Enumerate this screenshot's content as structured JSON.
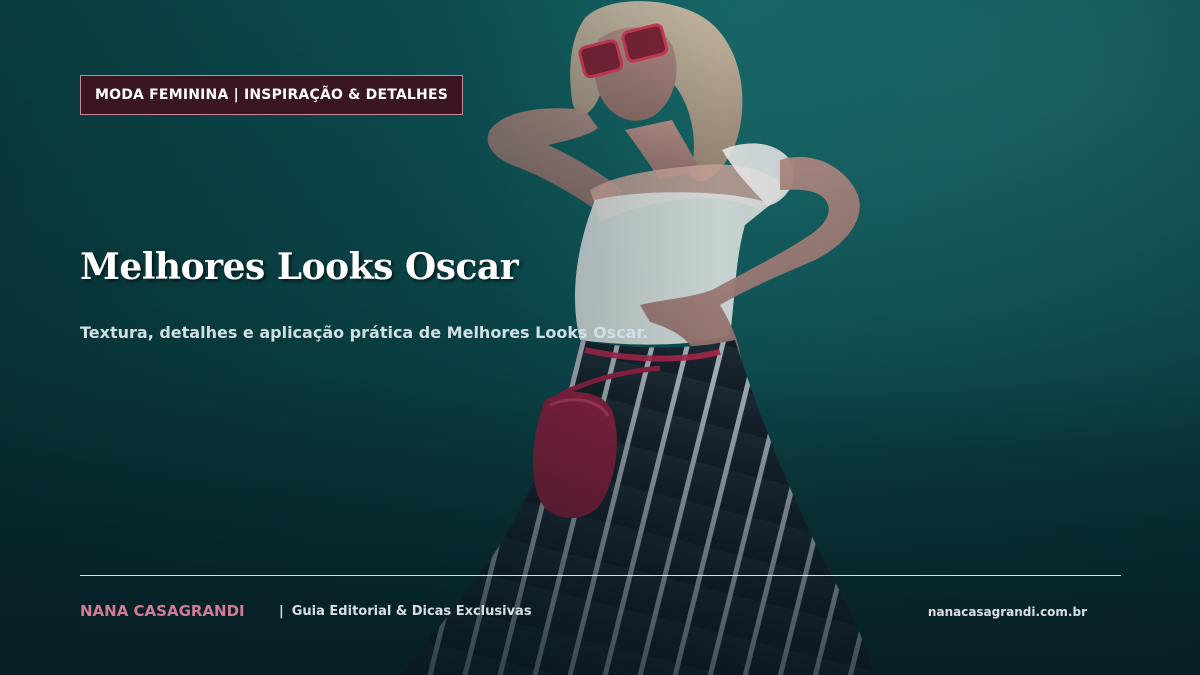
{
  "category_badge": "MODA FEMININA | INSPIRAÇÃO & DETALHES",
  "title": "Melhores Looks Oscar",
  "subtitle": "Textura, detalhes e aplicação prática de Melhores Looks Oscar.",
  "footer": {
    "brand": "NANA CASAGRANDI",
    "separator": "|",
    "tagline": "Guia Editorial & Dicas Exclusivas",
    "site_url": "nanacasagrandi.com.br"
  },
  "colors": {
    "background_teal": "#0f5d5e",
    "badge_background": "#3a1620",
    "badge_border": "#c98a97",
    "brand_pink": "#d27b95",
    "title_white": "#ffffff",
    "subtitle_text": "#cfe0e4"
  },
  "photo": {
    "subject": "woman-posing-against-teal-wall",
    "items": [
      "red-sunglasses",
      "white-off-shoulder-top",
      "black-white-striped-wide-pants",
      "red-belt-bag"
    ]
  }
}
